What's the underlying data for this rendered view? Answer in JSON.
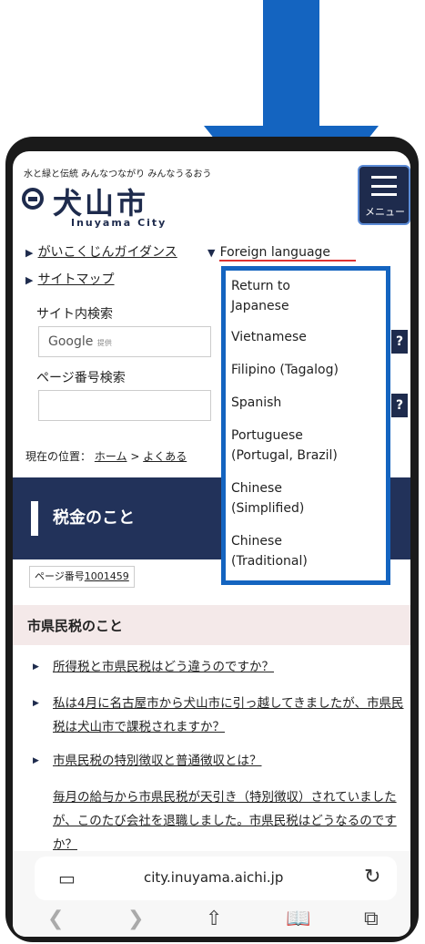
{
  "header": {
    "tagline": "水と緑と伝統 みんなつながり みんなうるおう",
    "logo_text": "犬山市",
    "logo_sub": "Inuyama City",
    "menu_label": "メニュー"
  },
  "nav": {
    "guidance": "がいこくじんガイダンス",
    "foreign_language": "Foreign language",
    "sitemap": "サイトマップ"
  },
  "search": {
    "site_search_label": "サイト内検索",
    "google_label": "Google",
    "google_small": "提供",
    "help_label": "?",
    "page_number_label": "ページ番号検索"
  },
  "breadcrumb": {
    "prefix": "現在の位置：",
    "home": "ホーム",
    "separator": ">",
    "current": "よくある"
  },
  "banner": {
    "title": "税金のこと"
  },
  "page_id": {
    "prefix": "ページ番号",
    "number": "1001459"
  },
  "section": {
    "title": "市県民税のこと"
  },
  "faq_items": [
    "所得税と市県民税はどう違うのですか？",
    "私は4月に名古屋市から犬山市に引っ越してきましたが、市県民税は犬山市で課税されますか？",
    "市県民税の特別徴収と普通徴収とは？",
    "毎月の給与から市県民税が天引き（特別徴収）されていましたが、このたび会社を退職しました。市県民税はどうなるのですか？"
  ],
  "dropdown": {
    "items": [
      "Return to\nJapanese",
      "Vietnamese",
      "Filipino (Tagalog)",
      "Spanish",
      "Portuguese\n(Portugal, Brazil)",
      "Chinese\n(Simplified)",
      "Chinese\n(Traditional)"
    ]
  },
  "browser": {
    "url": "city.inuyama.aichi.jp",
    "icons": [
      "tabs-icon",
      "reload-icon",
      "back-icon",
      "forward-icon",
      "share-icon",
      "bookmarks-icon",
      "tabs-overview-icon"
    ]
  },
  "colors": {
    "navy": "#1e2b4d",
    "arrow_blue": "#1464c0",
    "banner": "#22325a",
    "section_bg": "#f4e9e9"
  }
}
